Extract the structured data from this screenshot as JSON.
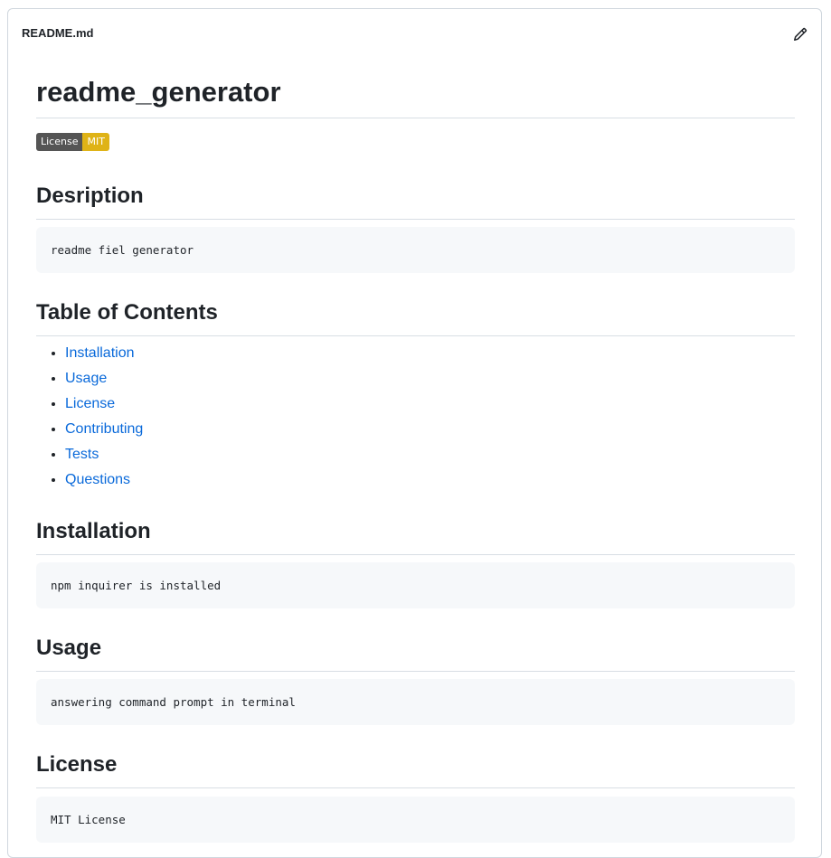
{
  "file": {
    "name": "README.md",
    "edit_icon": "pencil-icon"
  },
  "readme": {
    "title": "readme_generator",
    "badge": {
      "label": "License",
      "value": "MIT",
      "label_color": "#555555",
      "value_color": "#dfb317"
    },
    "description_heading": "Desription",
    "description_code": "readme fiel generator",
    "toc_heading": "Table of Contents",
    "toc": [
      {
        "label": "Installation"
      },
      {
        "label": "Usage"
      },
      {
        "label": "License"
      },
      {
        "label": "Contributing"
      },
      {
        "label": "Tests"
      },
      {
        "label": "Questions"
      }
    ],
    "installation_heading": "Installation",
    "installation_code": "npm inquirer is installed",
    "usage_heading": "Usage",
    "usage_code": "answering command prompt in terminal",
    "license_heading": "License",
    "license_code": "MIT License"
  },
  "colors": {
    "link": "#0969da",
    "code_bg": "#f6f8fa",
    "border": "#d0d7de"
  }
}
